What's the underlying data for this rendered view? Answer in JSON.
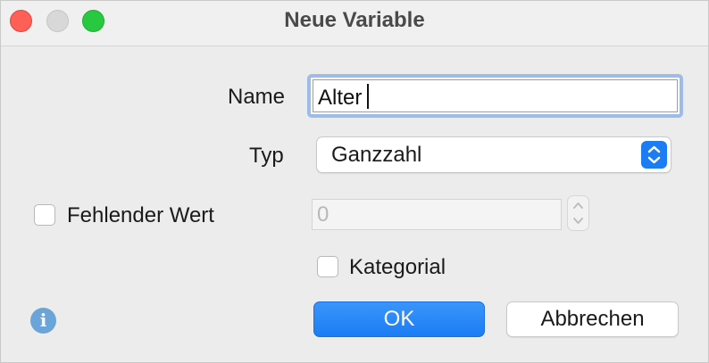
{
  "window": {
    "title": "Neue Variable"
  },
  "form": {
    "name_label": "Name",
    "name_value": "Alter",
    "type_label": "Typ",
    "type_value": "Ganzzahl",
    "missing_label": "Fehlender Wert",
    "missing_checked": false,
    "missing_value": "0",
    "categorical_label": "Kategorial",
    "categorical_checked": false
  },
  "buttons": {
    "ok_label": "OK",
    "cancel_label": "Abbrechen"
  },
  "icons": {
    "info": "info-icon",
    "close": "close-window-icon",
    "minimize": "minimize-window-icon",
    "maximize": "maximize-window-icon",
    "select_arrows": "chevron-up-down-icon",
    "spinner_arrows": "stepper-up-down-icon"
  },
  "colors": {
    "accent": "#1b7cf4",
    "focus_ring": "#9dbde8",
    "close": "#fe5f57",
    "maximize": "#28c840",
    "info": "#6aa4d8"
  }
}
